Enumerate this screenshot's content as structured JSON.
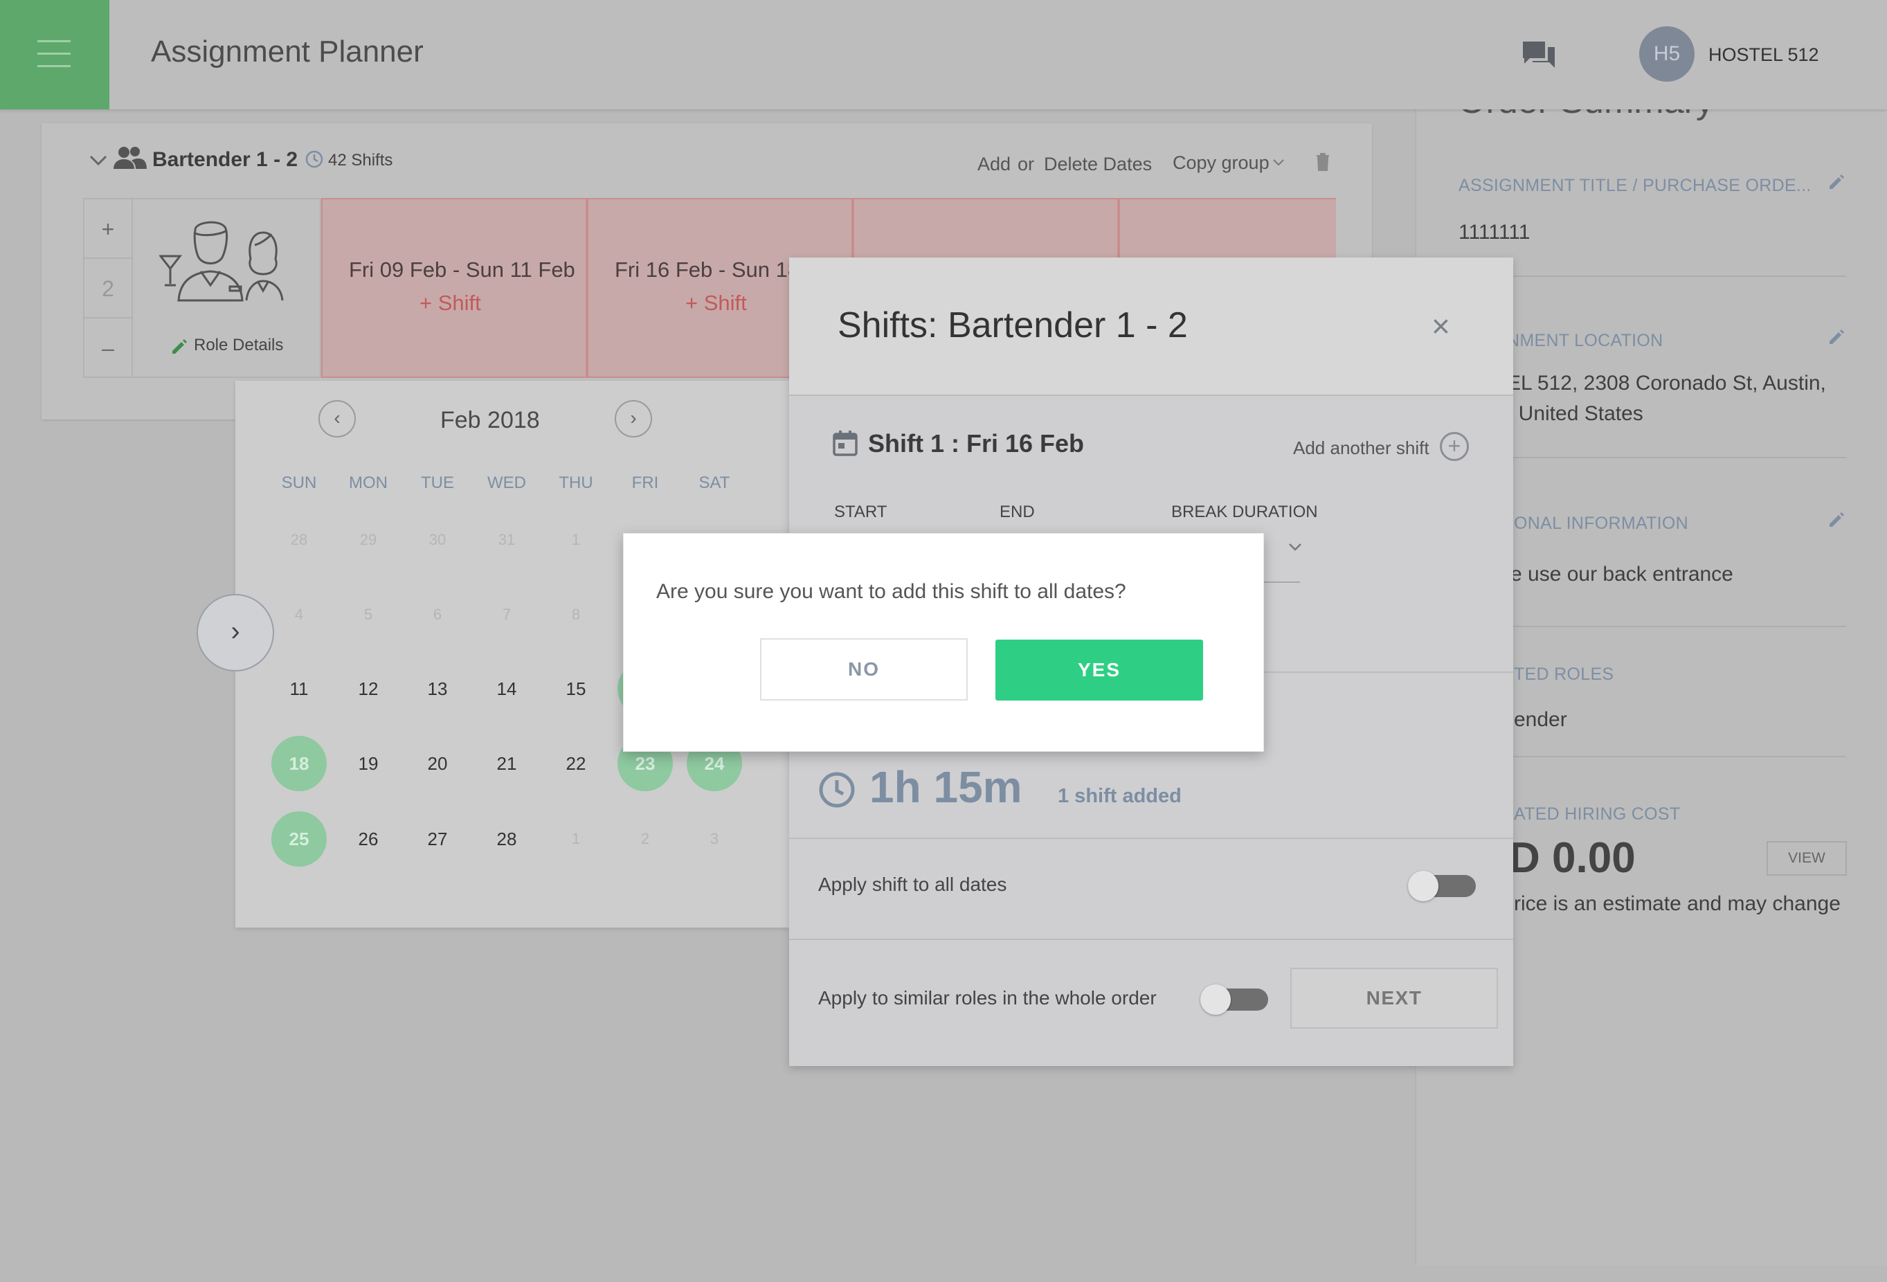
{
  "header": {
    "title": "Assignment Planner",
    "avatar_initials": "H5",
    "org_name": "HOSTEL 512"
  },
  "summary": {
    "heading": "Order Summary",
    "assignment_title_label": "ASSIGNMENT TITLE / PURCHASE ORDE...",
    "assignment_title_value": "1111111",
    "location_label": "NMENT LOCATION",
    "location_line1": "EL 512, 2308 Coronado St, Austin,",
    "location_line2": ", United States",
    "info_label": "ONAL INFORMATION",
    "info_value": "e use our back entrance",
    "roles_label": "TED ROLES",
    "roles_value": "ender",
    "cost_label": "ATED HIRING COST",
    "cost_value": "D 0.00",
    "view_label": "VIEW",
    "cost_note": "rice is an estimate and may change"
  },
  "role_card": {
    "title": "Bartender 1 - 2",
    "shift_count": "42 Shifts",
    "add_label": "Add",
    "or_label": "or",
    "delete_label": "Delete Dates",
    "copy_group_label": "Copy group",
    "stepper_plus": "+",
    "stepper_value": "2",
    "stepper_minus": "–",
    "role_details_label": "Role Details",
    "weeks": [
      {
        "date": "Fri 09 Feb - Sun 11 Feb",
        "add": "+ Shift"
      },
      {
        "date": "Fri 16 Feb - Sun 18",
        "add": "+ Shift"
      }
    ]
  },
  "calendar": {
    "month": "Feb 2018",
    "prev": "‹",
    "next": "›",
    "days_of_week": [
      "SUN",
      "MON",
      "TUE",
      "WED",
      "THU",
      "FRI",
      "SAT"
    ],
    "rows": [
      [
        "28",
        "29",
        "30",
        "31",
        "1",
        "",
        ""
      ],
      [
        "4",
        "5",
        "6",
        "7",
        "8",
        "",
        ""
      ],
      [
        "11",
        "12",
        "13",
        "14",
        "15",
        "",
        ""
      ],
      [
        "18",
        "19",
        "20",
        "21",
        "22",
        "23",
        "24"
      ],
      [
        "25",
        "26",
        "27",
        "28",
        "1",
        "2",
        "3"
      ]
    ],
    "side_arrow": "›"
  },
  "shifts_modal": {
    "title": "Shifts: Bartender 1 - 2",
    "close": "×",
    "shift_heading": "Shift 1 : Fri 16 Feb",
    "add_another": "Add another shift",
    "start_label": "START",
    "end_label": "END",
    "break_label": "BREAK DURATION",
    "duration": "1h 15m",
    "shift_added": "1 shift added",
    "apply_all_dates": "Apply shift to all dates",
    "apply_similar": "Apply to similar roles in the whole order",
    "next_label": "NEXT"
  },
  "confirm_dialog": {
    "message": "Are you sure you want to add this shift to all dates?",
    "no_label": "NO",
    "yes_label": "YES"
  },
  "colors": {
    "brand_green": "#2ecf84",
    "menu_green": "#5da86a",
    "label_blue_grey": "#7d8ea3",
    "shift_red": "#c25a5a"
  }
}
